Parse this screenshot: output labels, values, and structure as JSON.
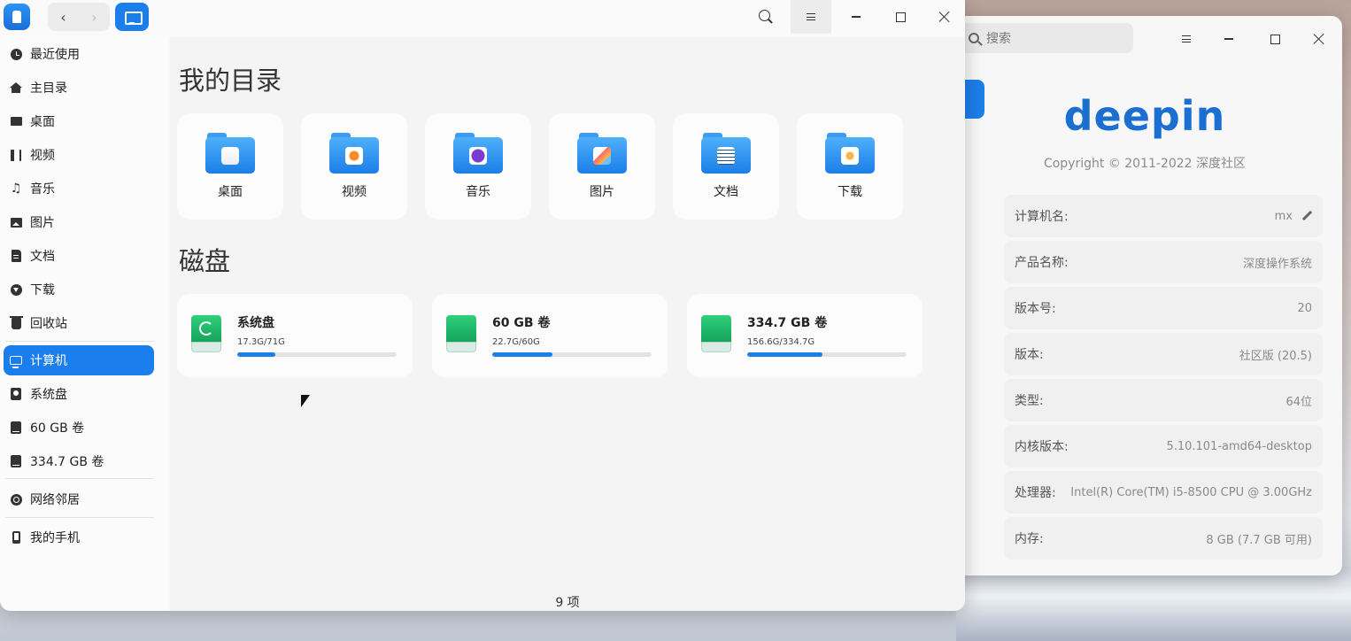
{
  "file_manager": {
    "toolbar": {
      "back_icon": "chevron-left-icon",
      "forward_icon": "chevron-right-icon",
      "breadcrumb_icon": "computer-icon"
    },
    "sidebar": {
      "items": [
        {
          "label": "最近使用",
          "icon": "clock-icon"
        },
        {
          "label": "主目录",
          "icon": "home-icon"
        },
        {
          "label": "桌面",
          "icon": "desktop-icon"
        },
        {
          "label": "视频",
          "icon": "video-icon"
        },
        {
          "label": "音乐",
          "icon": "music-icon"
        },
        {
          "label": "图片",
          "icon": "picture-icon"
        },
        {
          "label": "文档",
          "icon": "document-icon"
        },
        {
          "label": "下载",
          "icon": "download-icon"
        },
        {
          "label": "回收站",
          "icon": "trash-icon"
        },
        {
          "label": "计算机",
          "icon": "computer-icon",
          "active": true
        },
        {
          "label": "系统盘",
          "icon": "system-disk-icon"
        },
        {
          "label": "60 GB 卷",
          "icon": "disk-icon"
        },
        {
          "label": "334.7 GB 卷",
          "icon": "disk-icon"
        },
        {
          "label": "网络邻居",
          "icon": "network-icon"
        },
        {
          "label": "我的手机",
          "icon": "phone-icon"
        }
      ]
    },
    "main": {
      "my_dirs_title": "我的目录",
      "folders": [
        {
          "label": "桌面",
          "emblem": "desktop-emblem"
        },
        {
          "label": "视频",
          "emblem": "video-emblem"
        },
        {
          "label": "音乐",
          "emblem": "music-emblem"
        },
        {
          "label": "图片",
          "emblem": "picture-emblem"
        },
        {
          "label": "文档",
          "emblem": "document-emblem"
        },
        {
          "label": "下载",
          "emblem": "download-emblem"
        }
      ],
      "disks_title": "磁盘",
      "disks": [
        {
          "name": "系统盘",
          "usage": "17.3G/71G",
          "used_fraction": 0.24
        },
        {
          "name": "60 GB 卷",
          "usage": "22.7G/60G",
          "used_fraction": 0.38
        },
        {
          "name": "334.7 GB 卷",
          "usage": "156.6G/334.7G",
          "used_fraction": 0.47
        }
      ]
    },
    "status_bar": {
      "item_count": "9 项"
    }
  },
  "system_info": {
    "search_placeholder": "搜索",
    "logo_text": "deepin",
    "copyright": "Copyright © 2011-2022 深度社区",
    "rows": [
      {
        "key": "计算机名:",
        "value": "mx",
        "editable": true
      },
      {
        "key": "产品名称:",
        "value": "深度操作系统"
      },
      {
        "key": "版本号:",
        "value": "20"
      },
      {
        "key": "版本:",
        "value": "社区版 (20.5)"
      },
      {
        "key": "类型:",
        "value": "64位"
      },
      {
        "key": "内核版本:",
        "value": "5.10.101-amd64-desktop"
      },
      {
        "key": "处理器:",
        "value": "Intel(R) Core(TM) i5-8500 CPU @ 3.00GHz"
      },
      {
        "key": "内存:",
        "value": "8 GB (7.7 GB 可用)"
      }
    ]
  },
  "colors": {
    "accent": "#1a7fec",
    "disk_green": "#16a35a"
  }
}
